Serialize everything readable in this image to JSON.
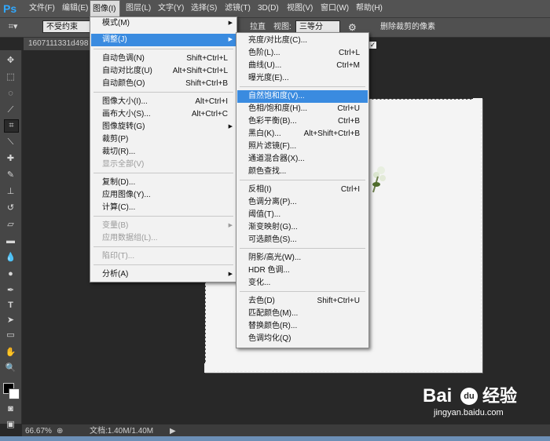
{
  "menubar": {
    "logo": "Ps",
    "items": [
      "文件(F)",
      "编辑(E)",
      "图像(I)",
      "图层(L)",
      "文字(Y)",
      "选择(S)",
      "滤镜(T)",
      "3D(D)",
      "视图(V)",
      "窗口(W)",
      "帮助(H)"
    ]
  },
  "options": {
    "ratio_value": "不受约束",
    "straighten_label": "拉直",
    "view_label": "视图:",
    "view_value": "三等分",
    "delete_pixels_label": "删除裁剪的像素"
  },
  "document": {
    "tab_title": "1607111331d498"
  },
  "image_menu": {
    "items": [
      {
        "label": "模式(M)",
        "shortcut": "",
        "submenu": true
      },
      {
        "label": "调整(J)",
        "shortcut": "",
        "submenu": true,
        "highlighted": true
      },
      {
        "label": "自动色调(N)",
        "shortcut": "Shift+Ctrl+L"
      },
      {
        "label": "自动对比度(U)",
        "shortcut": "Alt+Shift+Ctrl+L"
      },
      {
        "label": "自动颜色(O)",
        "shortcut": "Shift+Ctrl+B"
      },
      {
        "label": "图像大小(I)...",
        "shortcut": "Alt+Ctrl+I"
      },
      {
        "label": "画布大小(S)...",
        "shortcut": "Alt+Ctrl+C"
      },
      {
        "label": "图像旋转(G)",
        "shortcut": "",
        "submenu": true
      },
      {
        "label": "裁剪(P)",
        "shortcut": ""
      },
      {
        "label": "裁切(R)...",
        "shortcut": ""
      },
      {
        "label": "显示全部(V)",
        "shortcut": "",
        "disabled": true
      },
      {
        "label": "复制(D)...",
        "shortcut": ""
      },
      {
        "label": "应用图像(Y)...",
        "shortcut": ""
      },
      {
        "label": "计算(C)...",
        "shortcut": ""
      },
      {
        "label": "变量(B)",
        "shortcut": "",
        "submenu": true,
        "disabled": true
      },
      {
        "label": "应用数据组(L)...",
        "shortcut": "",
        "disabled": true
      },
      {
        "label": "陷印(T)...",
        "shortcut": "",
        "disabled": true
      },
      {
        "label": "分析(A)",
        "shortcut": "",
        "submenu": true
      }
    ]
  },
  "adjust_menu": {
    "items": [
      {
        "label": "亮度/对比度(C)...",
        "shortcut": ""
      },
      {
        "label": "色阶(L)...",
        "shortcut": "Ctrl+L"
      },
      {
        "label": "曲线(U)...",
        "shortcut": "Ctrl+M"
      },
      {
        "label": "曝光度(E)...",
        "shortcut": ""
      },
      {
        "label": "自然饱和度(V)...",
        "shortcut": "",
        "highlighted": true
      },
      {
        "label": "色相/饱和度(H)...",
        "shortcut": "Ctrl+U"
      },
      {
        "label": "色彩平衡(B)...",
        "shortcut": "Ctrl+B"
      },
      {
        "label": "黑白(K)...",
        "shortcut": "Alt+Shift+Ctrl+B"
      },
      {
        "label": "照片滤镜(F)...",
        "shortcut": ""
      },
      {
        "label": "通道混合器(X)...",
        "shortcut": ""
      },
      {
        "label": "颜色查找...",
        "shortcut": ""
      },
      {
        "label": "反相(I)",
        "shortcut": "Ctrl+I"
      },
      {
        "label": "色调分离(P)...",
        "shortcut": ""
      },
      {
        "label": "阈值(T)...",
        "shortcut": ""
      },
      {
        "label": "渐变映射(G)...",
        "shortcut": ""
      },
      {
        "label": "可选颜色(S)...",
        "shortcut": ""
      },
      {
        "label": "阴影/高光(W)...",
        "shortcut": ""
      },
      {
        "label": "HDR 色调...",
        "shortcut": ""
      },
      {
        "label": "变化...",
        "shortcut": ""
      },
      {
        "label": "去色(D)",
        "shortcut": "Shift+Ctrl+U"
      },
      {
        "label": "匹配颜色(M)...",
        "shortcut": ""
      },
      {
        "label": "替换颜色(R)...",
        "shortcut": ""
      },
      {
        "label": "色调均化(Q)",
        "shortcut": ""
      }
    ]
  },
  "status": {
    "zoom": "66.67%",
    "doc_size": "文档:1.40M/1.40M"
  },
  "watermark": {
    "text": "Bai",
    "paw": "du",
    "cn": "经验",
    "url": "jingyan.baidu.com"
  },
  "colors": {
    "menu_highlight": "#3a8be0",
    "ps_blue": "#31a8ff"
  }
}
